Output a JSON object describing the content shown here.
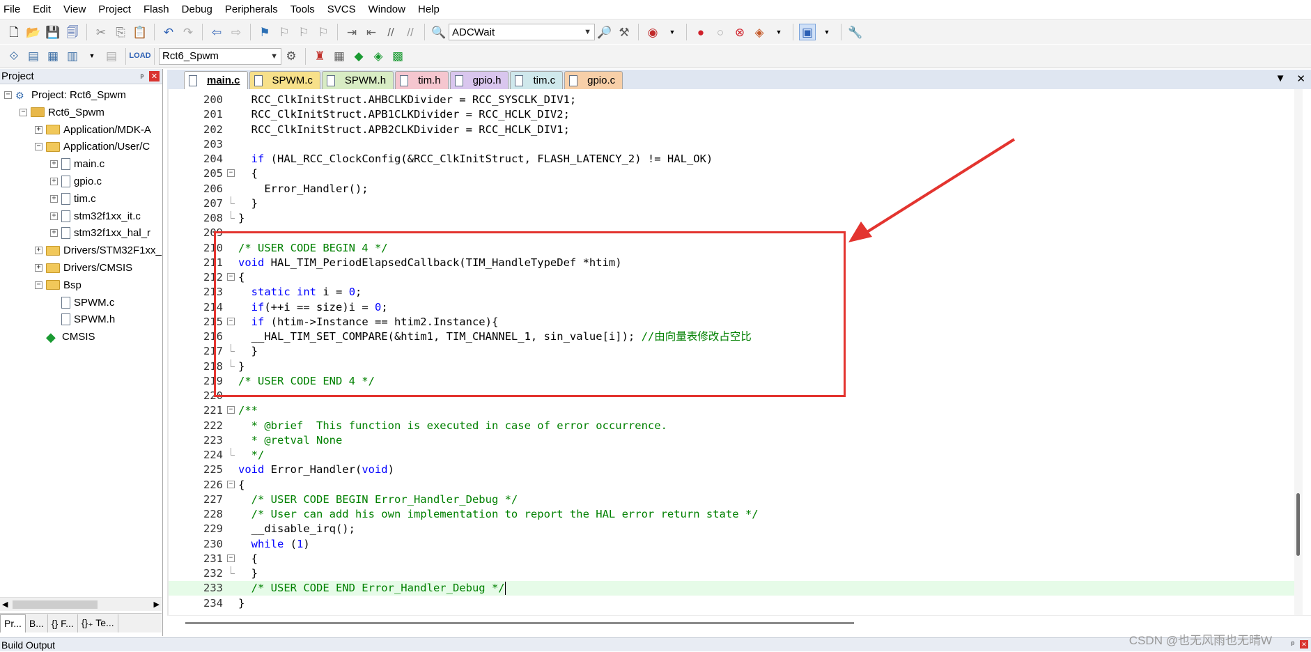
{
  "menu": [
    "File",
    "Edit",
    "View",
    "Project",
    "Flash",
    "Debug",
    "Peripherals",
    "Tools",
    "SVCS",
    "Window",
    "Help"
  ],
  "toolbar1": {
    "find_combo": "ADCWait"
  },
  "toolbar2": {
    "target_combo": "Rct6_Spwm"
  },
  "project_panel": {
    "title": "Project",
    "pin_glyph": "ᵖ",
    "close_glyph": "✕",
    "tree": [
      {
        "label": "Project: Rct6_Spwm",
        "depth": 0,
        "toggle": "−",
        "icon": "project"
      },
      {
        "label": "Rct6_Spwm",
        "depth": 1,
        "toggle": "−",
        "icon": "target"
      },
      {
        "label": "Application/MDK-A",
        "depth": 2,
        "toggle": "+",
        "icon": "folder"
      },
      {
        "label": "Application/User/C",
        "depth": 2,
        "toggle": "−",
        "icon": "folder"
      },
      {
        "label": "main.c",
        "depth": 3,
        "toggle": "+",
        "icon": "file"
      },
      {
        "label": "gpio.c",
        "depth": 3,
        "toggle": "+",
        "icon": "file"
      },
      {
        "label": "tim.c",
        "depth": 3,
        "toggle": "+",
        "icon": "file"
      },
      {
        "label": "stm32f1xx_it.c",
        "depth": 3,
        "toggle": "+",
        "icon": "file"
      },
      {
        "label": "stm32f1xx_hal_r",
        "depth": 3,
        "toggle": "+",
        "icon": "file"
      },
      {
        "label": "Drivers/STM32F1xx_",
        "depth": 2,
        "toggle": "+",
        "icon": "folder"
      },
      {
        "label": "Drivers/CMSIS",
        "depth": 2,
        "toggle": "+",
        "icon": "folder"
      },
      {
        "label": "Bsp",
        "depth": 2,
        "toggle": "−",
        "icon": "folder"
      },
      {
        "label": "SPWM.c",
        "depth": 3,
        "toggle": "",
        "icon": "file"
      },
      {
        "label": "SPWM.h",
        "depth": 3,
        "toggle": "",
        "icon": "file"
      },
      {
        "label": "CMSIS",
        "depth": 2,
        "toggle": "",
        "icon": "diamond"
      }
    ],
    "bottom_tabs": [
      "Pr...",
      "B...",
      "{} F...",
      "{}₊ Te..."
    ]
  },
  "editor_tabs": [
    {
      "label": "main.c",
      "color": "#ffffff",
      "active": true
    },
    {
      "label": "SPWM.c",
      "color": "#f7e08a",
      "active": false
    },
    {
      "label": "SPWM.h",
      "color": "#d8ecc4",
      "active": false
    },
    {
      "label": "tim.h",
      "color": "#f5c6cf",
      "active": false
    },
    {
      "label": "gpio.h",
      "color": "#d9c6ee",
      "active": false
    },
    {
      "label": "tim.c",
      "color": "#cfe8ec",
      "active": false
    },
    {
      "label": "gpio.c",
      "color": "#f7cfa8",
      "active": false
    }
  ],
  "editor_controls": {
    "dropdown": "▼",
    "close": "✕"
  },
  "code": [
    {
      "n": "200",
      "fold": "",
      "segs": [
        [
          "  RCC_ClkInitStruct.AHBCLKDivider = RCC_SYSCLK_DIV1;",
          ""
        ]
      ]
    },
    {
      "n": "201",
      "fold": "",
      "segs": [
        [
          "  RCC_ClkInitStruct.APB1CLKDivider = RCC_HCLK_DIV2;",
          ""
        ]
      ]
    },
    {
      "n": "202",
      "fold": "",
      "segs": [
        [
          "  RCC_ClkInitStruct.APB2CLKDivider = RCC_HCLK_DIV1;",
          ""
        ]
      ]
    },
    {
      "n": "203",
      "fold": "",
      "segs": []
    },
    {
      "n": "204",
      "fold": "",
      "segs": [
        [
          "  ",
          ""
        ],
        [
          "if",
          "kw"
        ],
        [
          " (HAL_RCC_ClockConfig(&RCC_ClkInitStruct, FLASH_LATENCY_2) != HAL_OK)",
          ""
        ]
      ]
    },
    {
      "n": "205",
      "fold": "box",
      "segs": [
        [
          "  {",
          ""
        ]
      ]
    },
    {
      "n": "206",
      "fold": "",
      "segs": [
        [
          "    Error_Handler();",
          ""
        ]
      ]
    },
    {
      "n": "207",
      "fold": "end",
      "segs": [
        [
          "  }",
          ""
        ]
      ]
    },
    {
      "n": "208",
      "fold": "end",
      "segs": [
        [
          "}",
          ""
        ]
      ]
    },
    {
      "n": "209",
      "fold": "",
      "segs": []
    },
    {
      "n": "210",
      "fold": "",
      "segs": [
        [
          "/* USER CODE BEGIN 4 */",
          "cm"
        ]
      ]
    },
    {
      "n": "211",
      "fold": "",
      "segs": [
        [
          "void",
          "kw"
        ],
        [
          " HAL_TIM_PeriodElapsedCallback(TIM_HandleTypeDef *htim)",
          ""
        ]
      ]
    },
    {
      "n": "212",
      "fold": "box",
      "segs": [
        [
          "{",
          ""
        ]
      ]
    },
    {
      "n": "213",
      "fold": "",
      "segs": [
        [
          "  ",
          ""
        ],
        [
          "static",
          "kw"
        ],
        [
          " ",
          ""
        ],
        [
          "int",
          "kw"
        ],
        [
          " i = ",
          ""
        ],
        [
          "0",
          "kw"
        ],
        [
          ";",
          ""
        ]
      ]
    },
    {
      "n": "214",
      "fold": "",
      "segs": [
        [
          "  ",
          ""
        ],
        [
          "if",
          "kw"
        ],
        [
          "(++i == size)i = ",
          ""
        ],
        [
          "0",
          "kw"
        ],
        [
          ";",
          ""
        ]
      ]
    },
    {
      "n": "215",
      "fold": "box",
      "segs": [
        [
          "  ",
          ""
        ],
        [
          "if",
          "kw"
        ],
        [
          " (htim->Instance == htim2.Instance){",
          ""
        ]
      ]
    },
    {
      "n": "216",
      "fold": "",
      "segs": [
        [
          "  __HAL_TIM_SET_COMPARE(&htim1, TIM_CHANNEL_1, sin_value[i]); ",
          ""
        ],
        [
          "//由向量表修改占空比",
          "cm"
        ]
      ]
    },
    {
      "n": "217",
      "fold": "end",
      "segs": [
        [
          "  }",
          ""
        ]
      ]
    },
    {
      "n": "218",
      "fold": "end",
      "segs": [
        [
          "}",
          ""
        ]
      ]
    },
    {
      "n": "219",
      "fold": "",
      "segs": [
        [
          "/* USER CODE END 4 */",
          "cm"
        ]
      ]
    },
    {
      "n": "220",
      "fold": "",
      "segs": []
    },
    {
      "n": "221",
      "fold": "box",
      "segs": [
        [
          "/**",
          "cm"
        ]
      ]
    },
    {
      "n": "222",
      "fold": "",
      "segs": [
        [
          "  * @brief  This function is executed in case of error occurrence.",
          "cm"
        ]
      ]
    },
    {
      "n": "223",
      "fold": "",
      "segs": [
        [
          "  * @retval None",
          "cm"
        ]
      ]
    },
    {
      "n": "224",
      "fold": "end",
      "segs": [
        [
          "  */",
          "cm"
        ]
      ]
    },
    {
      "n": "225",
      "fold": "",
      "segs": [
        [
          "void",
          "kw"
        ],
        [
          " Error_Handler(",
          ""
        ],
        [
          "void",
          "kw"
        ],
        [
          ")",
          ""
        ]
      ]
    },
    {
      "n": "226",
      "fold": "box",
      "segs": [
        [
          "{",
          ""
        ]
      ]
    },
    {
      "n": "227",
      "fold": "",
      "segs": [
        [
          "  /* USER CODE BEGIN Error_Handler_Debug */",
          "cm"
        ]
      ]
    },
    {
      "n": "228",
      "fold": "",
      "segs": [
        [
          "  /* User can add his own implementation to report the HAL error return state */",
          "cm"
        ]
      ]
    },
    {
      "n": "229",
      "fold": "",
      "segs": [
        [
          "  __disable_irq();",
          ""
        ]
      ]
    },
    {
      "n": "230",
      "fold": "",
      "segs": [
        [
          "  ",
          ""
        ],
        [
          "while",
          "kw"
        ],
        [
          " (",
          ""
        ],
        [
          "1",
          "kw"
        ],
        [
          ")",
          ""
        ]
      ]
    },
    {
      "n": "231",
      "fold": "box",
      "segs": [
        [
          "  {",
          ""
        ]
      ]
    },
    {
      "n": "232",
      "fold": "end",
      "segs": [
        [
          "  }",
          ""
        ]
      ]
    },
    {
      "n": "233",
      "fold": "",
      "hl": true,
      "segs": [
        [
          "  /* USER CODE END Error_Handler_Debug */",
          "cm"
        ]
      ]
    },
    {
      "n": "234",
      "fold": "",
      "segs": [
        [
          "}",
          ""
        ]
      ]
    }
  ],
  "highlight_color": "#e6fbe8",
  "annotation_color": "#e3342f",
  "build_output": "Build Output",
  "watermark": "CSDN @也无风雨也无晴W"
}
